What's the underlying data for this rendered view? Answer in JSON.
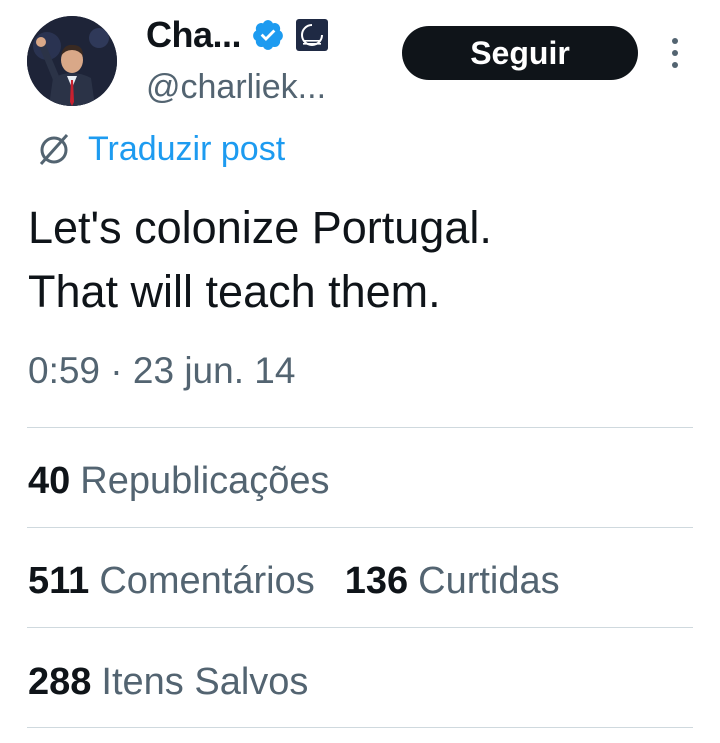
{
  "header": {
    "display_name": "Cha...",
    "handle": "@charliek...",
    "follow_label": "Seguir"
  },
  "translate": {
    "label": "Traduzir post"
  },
  "tweet": {
    "text": "Let's colonize Portugal.\nThat will teach them.",
    "timestamp": "0:59 · 23 jun. 14"
  },
  "stats": {
    "reposts": {
      "count": "40",
      "label": "Republicações"
    },
    "comments": {
      "count": "511",
      "label": "Comentários"
    },
    "likes": {
      "count": "136",
      "label": "Curtidas"
    },
    "bookmarks": {
      "count": "288",
      "label": "Itens Salvos"
    }
  },
  "colors": {
    "primary_text": "#0f1419",
    "secondary_text": "#536471",
    "link": "#1d9bf0",
    "verified": "#1d9bf0",
    "button_bg": "#0f1419",
    "divider": "#cfd9de"
  },
  "icons": {
    "verified": "verified-badge-icon",
    "org_badge": "organization-badge-icon",
    "more": "more-vertical-icon",
    "translate": "translate-icon"
  }
}
